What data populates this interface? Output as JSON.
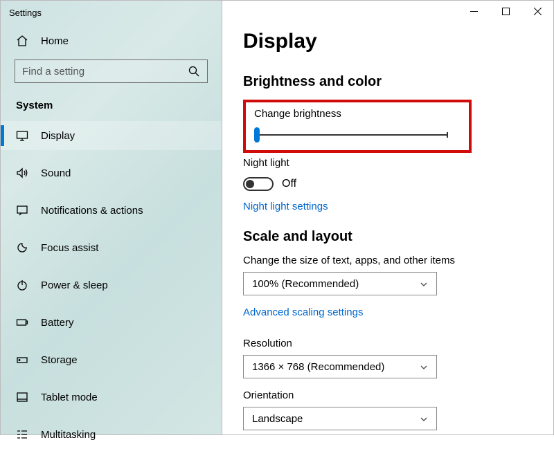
{
  "window": {
    "title": "Settings"
  },
  "home": {
    "label": "Home"
  },
  "search": {
    "placeholder": "Find a setting"
  },
  "sidebar": {
    "section": "System",
    "items": [
      {
        "label": "Display"
      },
      {
        "label": "Sound"
      },
      {
        "label": "Notifications & actions"
      },
      {
        "label": "Focus assist"
      },
      {
        "label": "Power & sleep"
      },
      {
        "label": "Battery"
      },
      {
        "label": "Storage"
      },
      {
        "label": "Tablet mode"
      },
      {
        "label": "Multitasking"
      }
    ]
  },
  "main": {
    "title": "Display",
    "brightness_section": "Brightness and color",
    "brightness_label": "Change brightness",
    "night_light_label": "Night light",
    "night_light_state": "Off",
    "night_light_link": "Night light settings",
    "scale_section": "Scale and layout",
    "scale_label": "Change the size of text, apps, and other items",
    "scale_value": "100% (Recommended)",
    "scale_link": "Advanced scaling settings",
    "resolution_label": "Resolution",
    "resolution_value": "1366 × 768 (Recommended)",
    "orientation_label": "Orientation",
    "orientation_value": "Landscape"
  }
}
